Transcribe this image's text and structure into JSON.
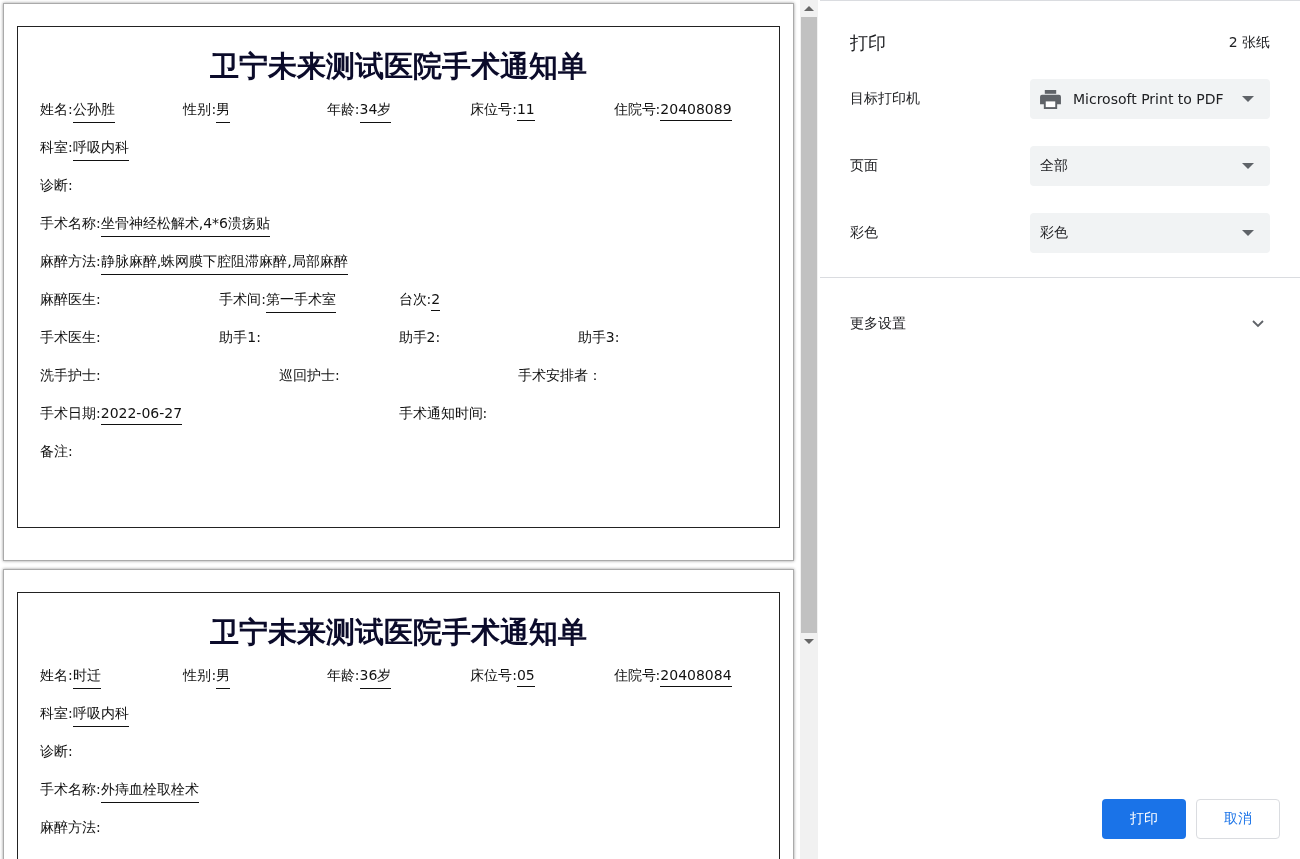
{
  "preview": {
    "pages": [
      {
        "title": "卫宁未来测试医院手术通知单",
        "rows": [
          [
            {
              "label": "姓名:",
              "value": "公孙胜"
            },
            {
              "label": "性别:",
              "value": "男"
            },
            {
              "label": "年龄:",
              "value": "34岁"
            },
            {
              "label": "床位号:",
              "value": "11"
            },
            {
              "label": "住院号:",
              "value": "20408089"
            }
          ],
          [
            {
              "label": "科室:",
              "value": "呼吸内科"
            }
          ],
          [
            {
              "label": "诊断:"
            }
          ],
          [
            {
              "label": "手术名称:",
              "value": "坐骨神经松解术,4*6溃疡贴"
            }
          ],
          [
            {
              "label": "麻醉方法:",
              "value": "静脉麻醉,蛛网膜下腔阻滞麻醉,局部麻醉"
            }
          ],
          [
            {
              "label": "麻醉医生:"
            },
            {
              "label": "手术间:",
              "value": "第一手术室"
            },
            {
              "label": "台次:",
              "value": "2"
            },
            {}
          ],
          [
            {
              "label": "手术医生:"
            },
            {
              "label": "助手1:"
            },
            {
              "label": "助手2:"
            },
            {
              "label": "助手3:"
            }
          ],
          [
            {
              "label": "洗手护士:"
            },
            {
              "label": "巡回护士:"
            },
            {
              "label": "手术安排者："
            }
          ],
          [
            {
              "label": "手术日期:",
              "value": "2022-06-27"
            },
            {
              "label": "手术通知时间:"
            }
          ],
          [
            {
              "label": "备注:"
            }
          ]
        ]
      },
      {
        "title": "卫宁未来测试医院手术通知单",
        "rows": [
          [
            {
              "label": "姓名:",
              "value": "时迁"
            },
            {
              "label": "性别:",
              "value": "男"
            },
            {
              "label": "年龄:",
              "value": "36岁"
            },
            {
              "label": "床位号:",
              "value": "05"
            },
            {
              "label": "住院号:",
              "value": "20408084"
            }
          ],
          [
            {
              "label": "科室:",
              "value": "呼吸内科"
            }
          ],
          [
            {
              "label": "诊断:"
            }
          ],
          [
            {
              "label": "手术名称:",
              "value": "外痔血栓取栓术"
            }
          ],
          [
            {
              "label": "麻醉方法:"
            }
          ]
        ]
      }
    ]
  },
  "panel": {
    "title": "打印",
    "sheets": "2 张纸",
    "settings": [
      {
        "label": "目标打印机",
        "value": "Microsoft Print to PDF",
        "kind": "printer"
      },
      {
        "label": "页面",
        "value": "全部",
        "kind": "plain"
      },
      {
        "label": "彩色",
        "value": "彩色",
        "kind": "plain"
      }
    ],
    "more": {
      "label": "更多设置",
      "expanded": false
    },
    "buttons": [
      {
        "label": "打印",
        "kind": "primary"
      },
      {
        "label": "取消",
        "kind": "secondary"
      }
    ]
  }
}
